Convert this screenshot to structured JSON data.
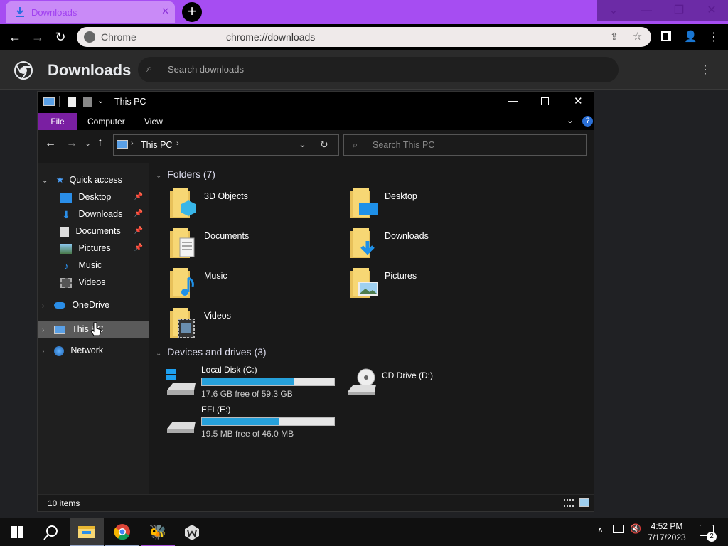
{
  "browser": {
    "tab_title": "Downloads",
    "omnibox_site": "Chrome",
    "omnibox_url": "chrome://downloads"
  },
  "downloads_page": {
    "title": "Downloads",
    "search_placeholder": "Search downloads"
  },
  "explorer": {
    "window_title": "This PC",
    "ribbon": {
      "file": "File",
      "computer": "Computer",
      "view": "View"
    },
    "address": {
      "crumb": "This PC"
    },
    "search_placeholder": "Search This PC",
    "nav": {
      "quick_access": "Quick access",
      "items": [
        {
          "label": "Desktop",
          "pinned": true
        },
        {
          "label": "Downloads",
          "pinned": true
        },
        {
          "label": "Documents",
          "pinned": true
        },
        {
          "label": "Pictures",
          "pinned": true
        },
        {
          "label": "Music",
          "pinned": false
        },
        {
          "label": "Videos",
          "pinned": false
        }
      ],
      "onedrive": "OneDrive",
      "this_pc": "This PC",
      "network": "Network"
    },
    "folders_header": "Folders (7)",
    "folders": [
      {
        "name": "3D Objects"
      },
      {
        "name": "Desktop"
      },
      {
        "name": "Documents"
      },
      {
        "name": "Downloads"
      },
      {
        "name": "Music"
      },
      {
        "name": "Pictures"
      },
      {
        "name": "Videos"
      }
    ],
    "drives_header": "Devices and drives (3)",
    "drives": [
      {
        "name": "Local Disk (C:)",
        "free": "17.6 GB free of 59.3 GB",
        "used_fraction": 0.7
      },
      {
        "name": "CD Drive (D:)"
      },
      {
        "name": "EFI (E:)",
        "free": "19.5 MB free of 46.0 MB",
        "used_fraction": 0.58
      }
    ],
    "status": "10 items"
  },
  "taskbar": {
    "time": "4:52 PM",
    "date": "7/17/2023",
    "notifications": "2"
  },
  "colors": {
    "accent": "#7a1fa2",
    "titlebar": "#a64df2",
    "drive_bar": "#26a0da"
  }
}
